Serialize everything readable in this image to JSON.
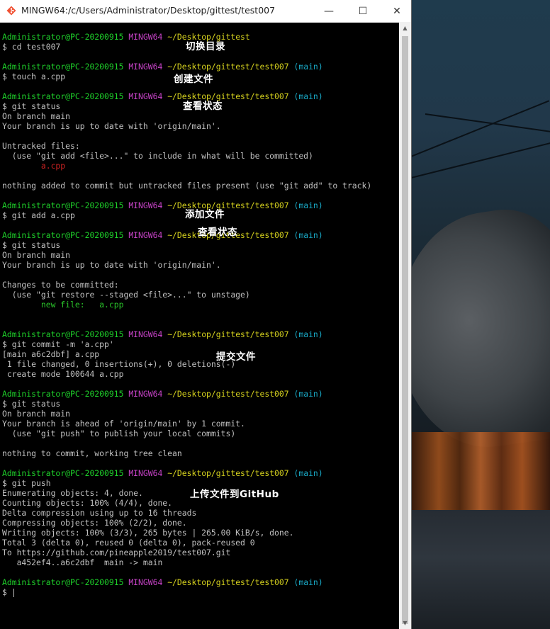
{
  "window": {
    "title": "MINGW64:/c/Users/Administrator/Desktop/gittest/test007",
    "minimize": "—",
    "maximize": "☐",
    "close": "✕"
  },
  "prompt": {
    "user_host": "Administrator@PC-20200915",
    "env": "MINGW64",
    "path_root": "~/Desktop/gittest",
    "path_repo": "~/Desktop/gittest/test007",
    "branch": "(main)"
  },
  "lines": [
    {
      "type": "prompt",
      "path": "~/Desktop/gittest",
      "branch": ""
    },
    {
      "type": "text",
      "text": "$ cd test007"
    },
    {
      "type": "blank"
    },
    {
      "type": "prompt",
      "path": "~/Desktop/gittest/test007",
      "branch": "(main)"
    },
    {
      "type": "text",
      "text": "$ touch a.cpp"
    },
    {
      "type": "blank"
    },
    {
      "type": "prompt",
      "path": "~/Desktop/gittest/test007",
      "branch": "(main)"
    },
    {
      "type": "text",
      "text": "$ git status"
    },
    {
      "type": "text",
      "text": "On branch main"
    },
    {
      "type": "text",
      "text": "Your branch is up to date with 'origin/main'."
    },
    {
      "type": "blank"
    },
    {
      "type": "text",
      "text": "Untracked files:"
    },
    {
      "type": "text",
      "text": "  (use \"git add <file>...\" to include in what will be committed)"
    },
    {
      "type": "red",
      "text": "        a.cpp"
    },
    {
      "type": "blank"
    },
    {
      "type": "text",
      "text": "nothing added to commit but untracked files present (use \"git add\" to track)"
    },
    {
      "type": "blank"
    },
    {
      "type": "prompt",
      "path": "~/Desktop/gittest/test007",
      "branch": "(main)"
    },
    {
      "type": "text",
      "text": "$ git add a.cpp"
    },
    {
      "type": "blank"
    },
    {
      "type": "prompt",
      "path": "~/Desktop/gittest/test007",
      "branch": "(main)"
    },
    {
      "type": "text",
      "text": "$ git status"
    },
    {
      "type": "text",
      "text": "On branch main"
    },
    {
      "type": "text",
      "text": "Your branch is up to date with 'origin/main'."
    },
    {
      "type": "blank"
    },
    {
      "type": "text",
      "text": "Changes to be committed:"
    },
    {
      "type": "text",
      "text": "  (use \"git restore --staged <file>...\" to unstage)"
    },
    {
      "type": "green",
      "text": "        new file:   a.cpp"
    },
    {
      "type": "blank"
    },
    {
      "type": "blank"
    },
    {
      "type": "prompt",
      "path": "~/Desktop/gittest/test007",
      "branch": "(main)"
    },
    {
      "type": "text",
      "text": "$ git commit -m 'a.cpp'"
    },
    {
      "type": "text",
      "text": "[main a6c2dbf] a.cpp"
    },
    {
      "type": "text",
      "text": " 1 file changed, 0 insertions(+), 0 deletions(-)"
    },
    {
      "type": "text",
      "text": " create mode 100644 a.cpp"
    },
    {
      "type": "blank"
    },
    {
      "type": "prompt",
      "path": "~/Desktop/gittest/test007",
      "branch": "(main)"
    },
    {
      "type": "text",
      "text": "$ git status"
    },
    {
      "type": "text",
      "text": "On branch main"
    },
    {
      "type": "text",
      "text": "Your branch is ahead of 'origin/main' by 1 commit."
    },
    {
      "type": "text",
      "text": "  (use \"git push\" to publish your local commits)"
    },
    {
      "type": "blank"
    },
    {
      "type": "text",
      "text": "nothing to commit, working tree clean"
    },
    {
      "type": "blank"
    },
    {
      "type": "prompt",
      "path": "~/Desktop/gittest/test007",
      "branch": "(main)"
    },
    {
      "type": "text",
      "text": "$ git push"
    },
    {
      "type": "text",
      "text": "Enumerating objects: 4, done."
    },
    {
      "type": "text",
      "text": "Counting objects: 100% (4/4), done."
    },
    {
      "type": "text",
      "text": "Delta compression using up to 16 threads"
    },
    {
      "type": "text",
      "text": "Compressing objects: 100% (2/2), done."
    },
    {
      "type": "text",
      "text": "Writing objects: 100% (3/3), 265 bytes | 265.00 KiB/s, done."
    },
    {
      "type": "text",
      "text": "Total 3 (delta 0), reused 0 (delta 0), pack-reused 0"
    },
    {
      "type": "text",
      "text": "To https://github.com/pineapple2019/test007.git"
    },
    {
      "type": "text",
      "text": "   a452ef4..a6c2dbf  main -> main"
    },
    {
      "type": "blank"
    },
    {
      "type": "prompt",
      "path": "~/Desktop/gittest/test007",
      "branch": "(main)"
    },
    {
      "type": "cursor",
      "text": "$ "
    }
  ],
  "annotations": [
    {
      "text": "切换目录",
      "line": 1
    },
    {
      "text": "创建文件",
      "line": 4
    },
    {
      "text": "查看状态",
      "line": 7
    },
    {
      "text": "添加文件",
      "line": 18
    },
    {
      "text": "查看状态",
      "line": 20
    },
    {
      "text": "提交文件",
      "line": 32
    },
    {
      "text": "上传文件到GitHub",
      "line": 46
    }
  ]
}
